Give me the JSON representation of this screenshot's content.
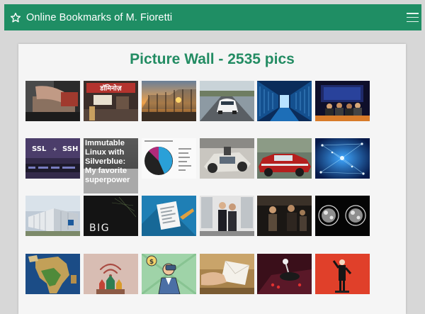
{
  "app": {
    "title": "Online Bookmarks of M. Fioretti"
  },
  "page": {
    "heading": "Picture Wall - 2535 pics"
  },
  "colors": {
    "header_bg": "#1f8e64",
    "heading": "#238c63",
    "card_bg": "#f5f5f5",
    "page_bg": "#d7d7d7"
  },
  "icons": {
    "title": "star-outline-icon",
    "menu": "hamburger-menu-icon"
  },
  "thumbs": [
    {
      "row": 1,
      "col": 1,
      "depicts": "hands repairing a machine"
    },
    {
      "row": 1,
      "col": 2,
      "depicts": "domino's storefront sign",
      "label": "डॉमिनोज़"
    },
    {
      "row": 1,
      "col": 3,
      "depicts": "greenhouse at sunset"
    },
    {
      "row": 1,
      "col": 4,
      "depicts": "electric car on road"
    },
    {
      "row": 1,
      "col": 5,
      "depicts": "data center server aisle"
    },
    {
      "row": 1,
      "col": 6,
      "depicts": "conference stage panel"
    },
    {
      "row": 2,
      "col": 1,
      "depicts": "SSL vs SSH graphic",
      "label_left": "SSL",
      "label_right": "SSH"
    },
    {
      "row": 2,
      "col": 2,
      "depicts": "text bookmark",
      "caption": "Immutable Linux with Silverblue: My favorite superpower"
    },
    {
      "row": 2,
      "col": 3,
      "depicts": "pie chart slide"
    },
    {
      "row": 2,
      "col": 4,
      "depicts": "car chassis in workshop"
    },
    {
      "row": 2,
      "col": 5,
      "depicts": "red classic car"
    },
    {
      "row": 2,
      "col": 6,
      "depicts": "blue neural network graphic"
    },
    {
      "row": 3,
      "col": 1,
      "depicts": "modular building rendering"
    },
    {
      "row": 3,
      "col": 2,
      "depicts": "BIG dark poster",
      "label": "BIG"
    },
    {
      "row": 3,
      "col": 3,
      "depicts": "document illustration"
    },
    {
      "row": 3,
      "col": 4,
      "depicts": "two people by a window"
    },
    {
      "row": 3,
      "col": 5,
      "depicts": "people in dark room"
    },
    {
      "row": 3,
      "col": 6,
      "depicts": "medical brain scans"
    },
    {
      "row": 4,
      "col": 1,
      "depicts": "satellite map of Africa"
    },
    {
      "row": 4,
      "col": 2,
      "depicts": "kremlin with wifi symbol"
    },
    {
      "row": 4,
      "col": 3,
      "depicts": "man with binoculars cartoon"
    },
    {
      "row": 4,
      "col": 4,
      "depicts": "hand holding envelope"
    },
    {
      "row": 4,
      "col": 5,
      "depicts": "joystick on red background"
    },
    {
      "row": 4,
      "col": 6,
      "depicts": "statue on red background"
    }
  ]
}
